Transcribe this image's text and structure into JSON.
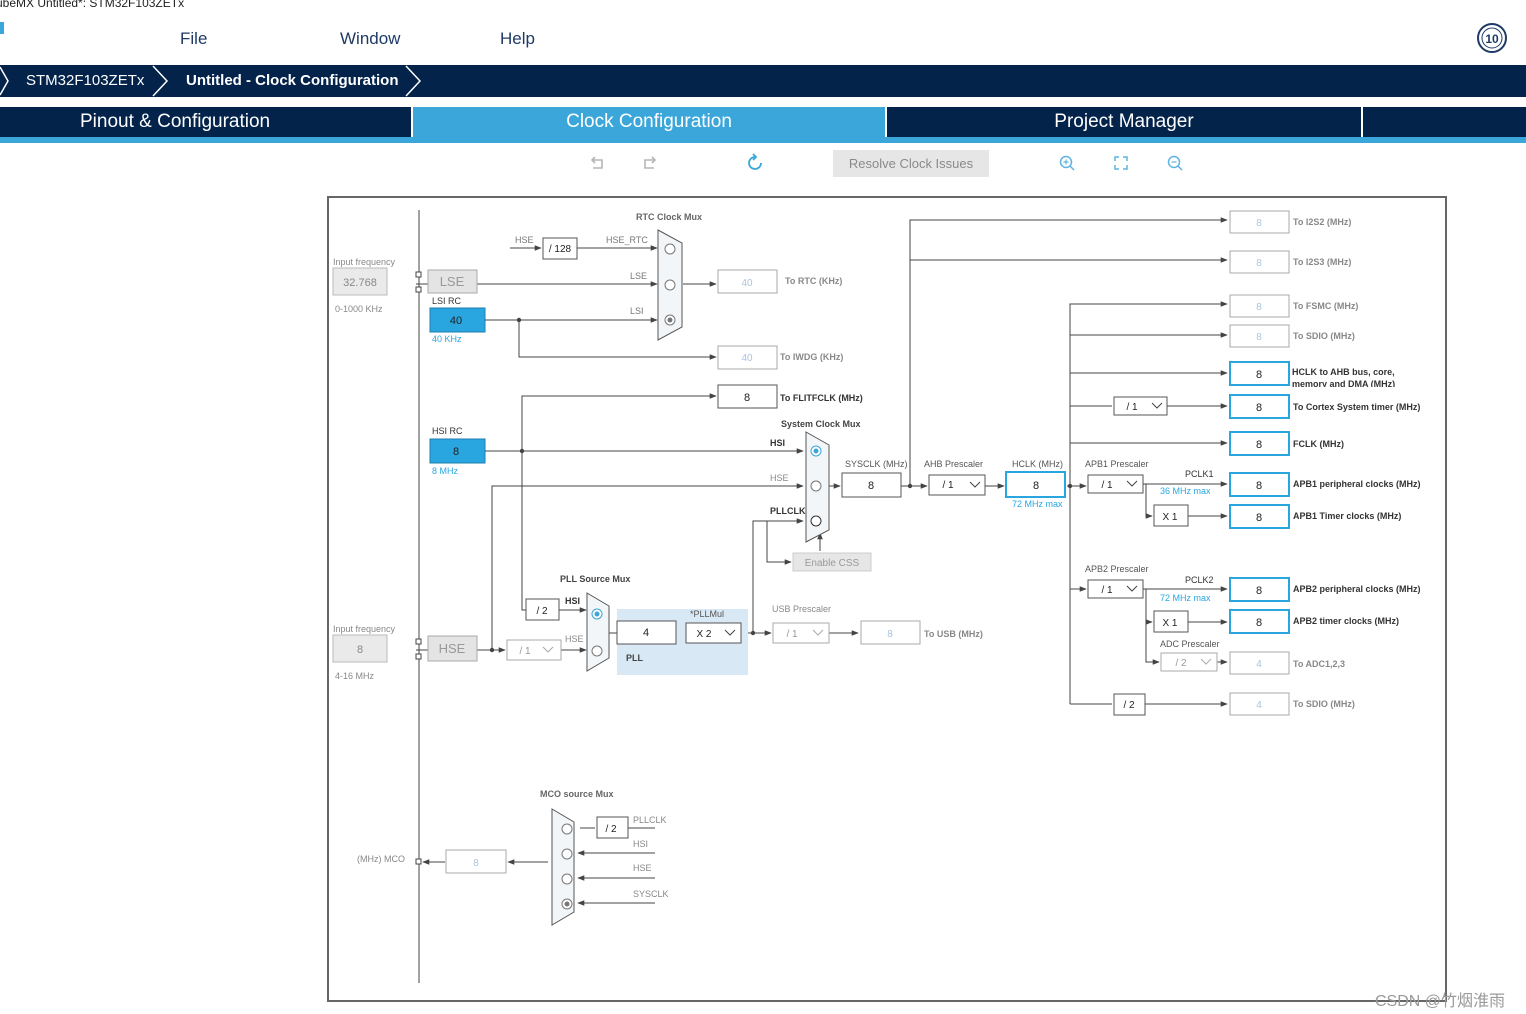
{
  "window": {
    "title": "ubeMX Untitled*: STM32F103ZETx"
  },
  "menu": {
    "items": [
      "File",
      "Window",
      "Help"
    ]
  },
  "badge": {
    "label": "10"
  },
  "breadcrumb": {
    "items": [
      "STM32F103ZETx",
      "Untitled - Clock Configuration"
    ]
  },
  "tabs": {
    "pinout": "Pinout & Configuration",
    "clock": "Clock Configuration",
    "project": "Project Manager"
  },
  "toolbar": {
    "resolve": "Resolve Clock Issues"
  },
  "icons": {
    "undo": "undo-icon",
    "redo": "redo-icon",
    "refresh": "refresh-icon",
    "zoom_in": "zoom-in-icon",
    "fit": "fit-screen-icon",
    "zoom_out": "zoom-out-icon"
  },
  "colors": {
    "navy": "#03234b",
    "accent": "#3ba6d9",
    "highlight": "#29a6e0",
    "pll_area": "#d9e8f5"
  },
  "clock": {
    "lse_input": {
      "label": "Input frequency",
      "value": "32.768",
      "range": "0-1000 KHz"
    },
    "hse_input": {
      "label": "Input frequency",
      "value": "8",
      "range": "4-16 MHz"
    },
    "lse": "LSE",
    "lsi": {
      "label": "LSI RC",
      "value": "40",
      "unit": "40 KHz"
    },
    "hsi": {
      "label": "HSI RC",
      "value": "8",
      "unit": "8 MHz"
    },
    "hse": "HSE",
    "rtc_mux": {
      "title": "RTC Clock Mux",
      "hse": "HSE",
      "div": "/ 128",
      "hse_rtc": "HSE_RTC",
      "lse": "LSE",
      "lsi": "LSI"
    },
    "rtc_out": {
      "value": "40",
      "label": "To RTC (KHz)"
    },
    "iwdg_out": {
      "value": "40",
      "label": "To IWDG (KHz)"
    },
    "flit_out": {
      "value": "8",
      "label": "To FLITFCLK (MHz)"
    },
    "sys_mux": {
      "title": "System Clock Mux",
      "hsi": "HSI",
      "hse": "HSE",
      "pllclk": "PLLCLK"
    },
    "enable_css": "Enable CSS",
    "sysclk": {
      "label": "SYSCLK (MHz)",
      "value": "8"
    },
    "ahb": {
      "label": "AHB Prescaler",
      "value": "/ 1"
    },
    "hclk": {
      "label": "HCLK (MHz)",
      "value": "8",
      "max": "72 MHz max"
    },
    "pll_mux": {
      "title": "PLL Source Mux",
      "div2": "/ 2",
      "hsi": "HSI",
      "hse": "HSE",
      "hse_div": "/ 1"
    },
    "pll": {
      "value": "4",
      "mul_label": "*PLLMul",
      "mul": "X 2",
      "label": "PLL"
    },
    "usb": {
      "label": "USB Prescaler",
      "div": "/ 1",
      "value": "8",
      "out": "To USB (MHz)"
    },
    "apb1": {
      "label": "APB1 Prescaler",
      "value": "/ 1",
      "pclk": "PCLK1",
      "max": "36 MHz max",
      "x": "X 1"
    },
    "apb2": {
      "label": "APB2 Prescaler",
      "value": "/ 1",
      "pclk": "PCLK2",
      "max": "72 MHz max",
      "x": "X 1"
    },
    "adc": {
      "label": "ADC Prescaler",
      "value": "/ 2"
    },
    "cortex_div": "/ 1",
    "sdio_div": "/ 2",
    "outputs": [
      {
        "value": "8",
        "label": "To I2S2 (MHz)"
      },
      {
        "value": "8",
        "label": "To I2S3 (MHz)"
      },
      {
        "value": "8",
        "label": "To FSMC (MHz)"
      },
      {
        "value": "8",
        "label": "To SDIO (MHz)"
      },
      {
        "value": "8",
        "label": "HCLK to AHB bus, core, memory and DMA (MHz)"
      },
      {
        "value": "8",
        "label": "To Cortex System timer (MHz)"
      },
      {
        "value": "8",
        "label": "FCLK (MHz)"
      },
      {
        "value": "8",
        "label": "APB1 peripheral clocks (MHz)"
      },
      {
        "value": "8",
        "label": "APB1 Timer clocks (MHz)"
      },
      {
        "value": "8",
        "label": "APB2 peripheral clocks (MHz)"
      },
      {
        "value": "8",
        "label": "APB2 timer clocks (MHz)"
      },
      {
        "value": "4",
        "label": "To ADC1,2,3"
      },
      {
        "value": "4",
        "label": "To SDIO (MHz)"
      }
    ],
    "mco": {
      "title": "MCO source Mux",
      "div2": "/ 2",
      "pllclk": "PLLCLK",
      "hsi": "HSI",
      "hse": "HSE",
      "sysclk": "SYSCLK",
      "value": "8",
      "label": "(MHz) MCO"
    }
  },
  "watermark": "CSDN @竹烟淮雨"
}
